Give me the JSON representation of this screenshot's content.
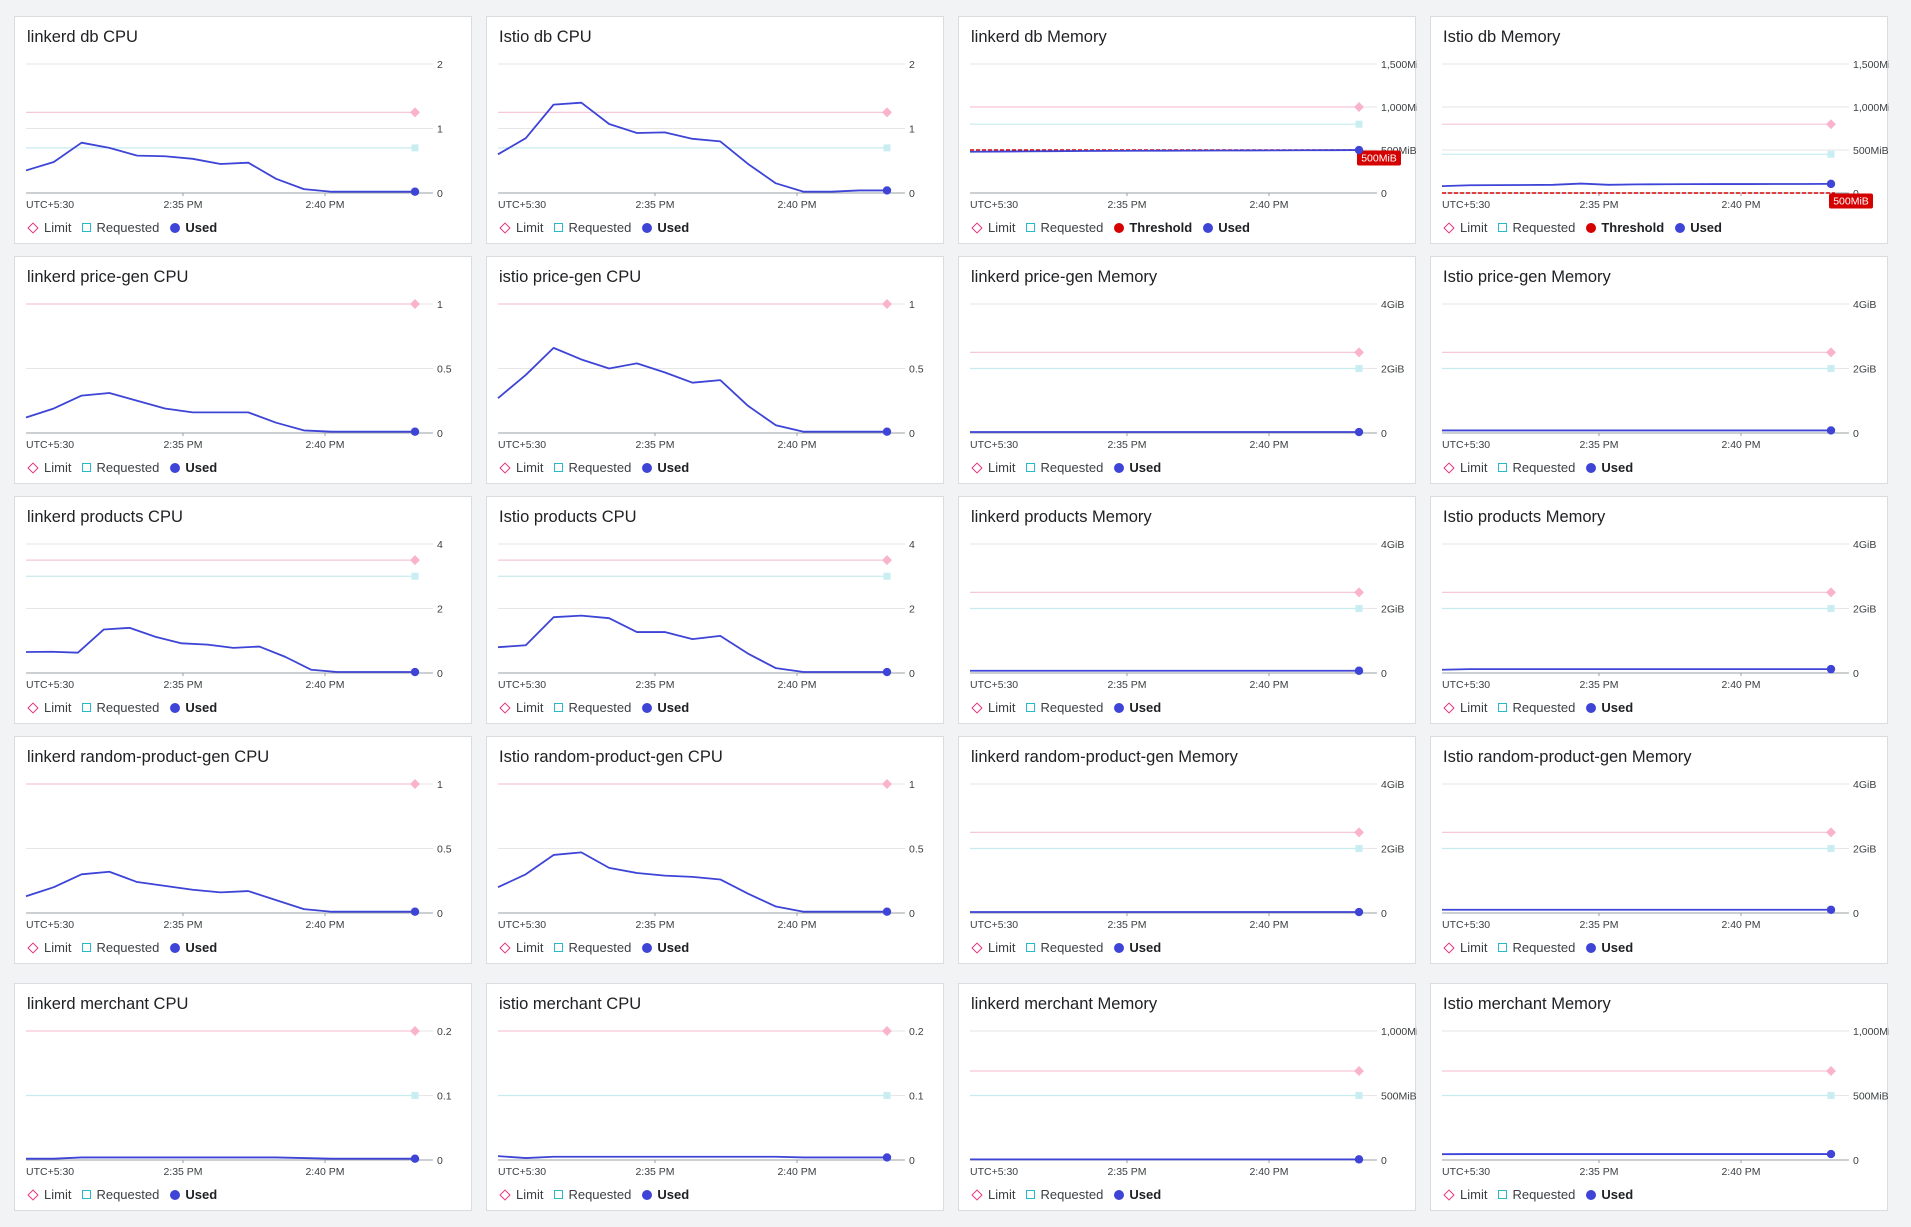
{
  "legend_labels": {
    "limit": "Limit",
    "requested": "Requested",
    "threshold": "Threshold",
    "used": "Used"
  },
  "colors": {
    "used": "#3d44d6",
    "limit": "#f6c6d9",
    "limit_marker": "#f9b3cd",
    "requested": "#c6ecef",
    "requested_marker": "#c9eef2",
    "threshold": "#d50000",
    "grid": "#e6e6e6",
    "axis": "#9aa0a6"
  },
  "chart_data": [
    {
      "type": "line",
      "title": "linkerd db CPU",
      "timezone_label": "UTC+5:30",
      "x_ticks": [
        "2:35 PM",
        "2:40 PM"
      ],
      "y_ticks": [
        "0",
        "1",
        "2"
      ],
      "ylim": [
        0,
        2
      ],
      "limit": 1.25,
      "requested": 0.7,
      "used": [
        0.35,
        0.48,
        0.78,
        0.7,
        0.58,
        0.57,
        0.53,
        0.45,
        0.47,
        0.22,
        0.06,
        0.02,
        0.02,
        0.02,
        0.02
      ]
    },
    {
      "type": "line",
      "title": "Istio db CPU",
      "timezone_label": "UTC+5:30",
      "x_ticks": [
        "2:35 PM",
        "2:40 PM"
      ],
      "y_ticks": [
        "0",
        "1",
        "2"
      ],
      "ylim": [
        0,
        2
      ],
      "limit": 1.25,
      "requested": 0.7,
      "used": [
        0.6,
        0.85,
        1.37,
        1.4,
        1.07,
        0.93,
        0.94,
        0.84,
        0.8,
        0.45,
        0.15,
        0.02,
        0.02,
        0.04,
        0.04
      ]
    },
    {
      "type": "line",
      "title": "linkerd db Memory",
      "timezone_label": "UTC+5:30",
      "x_ticks": [
        "2:35 PM",
        "2:40 PM"
      ],
      "y_ticks": [
        "0",
        "500MiB",
        "1,000MiB",
        "1,500MiB"
      ],
      "ylim": [
        0,
        1500
      ],
      "limit": 1000,
      "requested": 800,
      "threshold": 500,
      "threshold_label": "500MiB",
      "used": [
        480,
        482,
        484,
        486,
        488,
        490,
        491,
        492,
        493,
        494,
        495,
        496,
        497,
        498,
        499
      ]
    },
    {
      "type": "line",
      "title": "Istio db Memory",
      "timezone_label": "UTC+5:30",
      "x_ticks": [
        "2:35 PM",
        "2:40 PM"
      ],
      "y_ticks": [
        "0",
        "500MiB",
        "1,000MiB",
        "1,500MiB"
      ],
      "ylim": [
        0,
        1500
      ],
      "limit": 800,
      "requested": 450,
      "threshold": 0,
      "threshold_label": "500MiB",
      "used": [
        80,
        90,
        92,
        93,
        95,
        110,
        95,
        100,
        102,
        103,
        104,
        104,
        105,
        105,
        106
      ]
    },
    {
      "type": "line",
      "title": "linkerd price-gen CPU",
      "timezone_label": "UTC+5:30",
      "x_ticks": [
        "2:35 PM",
        "2:40 PM"
      ],
      "y_ticks": [
        "0",
        "0.5",
        "1"
      ],
      "ylim": [
        0,
        1
      ],
      "limit": 1.0,
      "requested": null,
      "used": [
        0.12,
        0.19,
        0.29,
        0.31,
        0.25,
        0.19,
        0.16,
        0.16,
        0.16,
        0.08,
        0.02,
        0.01,
        0.01,
        0.01,
        0.01
      ]
    },
    {
      "type": "line",
      "title": "istio price-gen CPU",
      "timezone_label": "UTC+5:30",
      "x_ticks": [
        "2:35 PM",
        "2:40 PM"
      ],
      "y_ticks": [
        "0",
        "0.5",
        "1"
      ],
      "ylim": [
        0,
        1
      ],
      "limit": 1.0,
      "requested": null,
      "used": [
        0.27,
        0.45,
        0.66,
        0.57,
        0.5,
        0.54,
        0.47,
        0.39,
        0.41,
        0.21,
        0.06,
        0.01,
        0.01,
        0.01,
        0.01
      ]
    },
    {
      "type": "line",
      "title": "linkerd price-gen Memory",
      "timezone_label": "UTC+5:30",
      "x_ticks": [
        "2:35 PM",
        "2:40 PM"
      ],
      "y_ticks": [
        "0",
        "2GiB",
        "4GiB"
      ],
      "ylim": [
        0,
        4
      ],
      "limit": 2.5,
      "requested": 2.0,
      "used": [
        0.03,
        0.03,
        0.03,
        0.03,
        0.03,
        0.03,
        0.03,
        0.03,
        0.03,
        0.03,
        0.03,
        0.03,
        0.03,
        0.03,
        0.03
      ]
    },
    {
      "type": "line",
      "title": "Istio price-gen Memory",
      "timezone_label": "UTC+5:30",
      "x_ticks": [
        "2:35 PM",
        "2:40 PM"
      ],
      "y_ticks": [
        "0",
        "2GiB",
        "4GiB"
      ],
      "ylim": [
        0,
        4
      ],
      "limit": 2.5,
      "requested": 2.0,
      "used": [
        0.08,
        0.08,
        0.08,
        0.08,
        0.08,
        0.08,
        0.08,
        0.08,
        0.08,
        0.08,
        0.08,
        0.08,
        0.08,
        0.08,
        0.08
      ]
    },
    {
      "type": "line",
      "title": "linkerd products CPU",
      "timezone_label": "UTC+5:30",
      "x_ticks": [
        "2:35 PM",
        "2:40 PM"
      ],
      "y_ticks": [
        "0",
        "2",
        "4"
      ],
      "ylim": [
        0,
        4
      ],
      "limit": 3.5,
      "requested": 3.0,
      "used": [
        0.65,
        0.66,
        0.63,
        1.35,
        1.4,
        1.12,
        0.92,
        0.88,
        0.78,
        0.82,
        0.5,
        0.1,
        0.03,
        0.03,
        0.03,
        0.03
      ]
    },
    {
      "type": "line",
      "title": "Istio products CPU",
      "timezone_label": "UTC+5:30",
      "x_ticks": [
        "2:35 PM",
        "2:40 PM"
      ],
      "y_ticks": [
        "0",
        "2",
        "4"
      ],
      "ylim": [
        0,
        4
      ],
      "limit": 3.5,
      "requested": 3.0,
      "used": [
        0.8,
        0.86,
        1.73,
        1.78,
        1.7,
        1.27,
        1.27,
        1.05,
        1.15,
        0.6,
        0.15,
        0.03,
        0.03,
        0.03,
        0.03
      ]
    },
    {
      "type": "line",
      "title": "linkerd products Memory",
      "timezone_label": "UTC+5:30",
      "x_ticks": [
        "2:35 PM",
        "2:40 PM"
      ],
      "y_ticks": [
        "0",
        "2GiB",
        "4GiB"
      ],
      "ylim": [
        0,
        4
      ],
      "limit": 2.5,
      "requested": 2.0,
      "used": [
        0.07,
        0.07,
        0.07,
        0.07,
        0.07,
        0.07,
        0.07,
        0.07,
        0.07,
        0.07,
        0.07,
        0.07,
        0.07,
        0.07,
        0.07
      ]
    },
    {
      "type": "line",
      "title": "Istio products Memory",
      "timezone_label": "UTC+5:30",
      "x_ticks": [
        "2:35 PM",
        "2:40 PM"
      ],
      "y_ticks": [
        "0",
        "2GiB",
        "4GiB"
      ],
      "ylim": [
        0,
        4
      ],
      "limit": 2.5,
      "requested": 2.0,
      "used": [
        0.1,
        0.12,
        0.12,
        0.12,
        0.12,
        0.12,
        0.12,
        0.12,
        0.12,
        0.12,
        0.12,
        0.12,
        0.12,
        0.12,
        0.12
      ]
    },
    {
      "type": "line",
      "title": "linkerd random-product-gen CPU",
      "timezone_label": "UTC+5:30",
      "x_ticks": [
        "2:35 PM",
        "2:40 PM"
      ],
      "y_ticks": [
        "0",
        "0.5",
        "1"
      ],
      "ylim": [
        0,
        1
      ],
      "limit": 1.0,
      "requested": null,
      "used": [
        0.13,
        0.2,
        0.3,
        0.32,
        0.24,
        0.21,
        0.18,
        0.16,
        0.17,
        0.1,
        0.03,
        0.01,
        0.01,
        0.01,
        0.01
      ]
    },
    {
      "type": "line",
      "title": "Istio random-product-gen CPU",
      "timezone_label": "UTC+5:30",
      "x_ticks": [
        "2:35 PM",
        "2:40 PM"
      ],
      "y_ticks": [
        "0",
        "0.5",
        "1"
      ],
      "ylim": [
        0,
        1
      ],
      "limit": 1.0,
      "requested": null,
      "used": [
        0.2,
        0.3,
        0.45,
        0.47,
        0.35,
        0.31,
        0.29,
        0.28,
        0.26,
        0.15,
        0.05,
        0.01,
        0.01,
        0.01,
        0.01
      ]
    },
    {
      "type": "line",
      "title": "linkerd random-product-gen Memory",
      "timezone_label": "UTC+5:30",
      "x_ticks": [
        "2:35 PM",
        "2:40 PM"
      ],
      "y_ticks": [
        "0",
        "2GiB",
        "4GiB"
      ],
      "ylim": [
        0,
        4
      ],
      "limit": 2.5,
      "requested": 2.0,
      "used": [
        0.03,
        0.03,
        0.03,
        0.03,
        0.03,
        0.03,
        0.03,
        0.03,
        0.03,
        0.03,
        0.03,
        0.03,
        0.03,
        0.03,
        0.03
      ]
    },
    {
      "type": "line",
      "title": "Istio random-product-gen Memory",
      "timezone_label": "UTC+5:30",
      "x_ticks": [
        "2:35 PM",
        "2:40 PM"
      ],
      "y_ticks": [
        "0",
        "2GiB",
        "4GiB"
      ],
      "ylim": [
        0,
        4
      ],
      "limit": 2.5,
      "requested": 2.0,
      "used": [
        0.1,
        0.1,
        0.1,
        0.1,
        0.1,
        0.1,
        0.1,
        0.1,
        0.1,
        0.1,
        0.1,
        0.1,
        0.1,
        0.1,
        0.1
      ]
    },
    {
      "type": "line",
      "title": "linkerd merchant CPU",
      "timezone_label": "UTC+5:30",
      "x_ticks": [
        "2:35 PM",
        "2:40 PM"
      ],
      "y_ticks": [
        "0",
        "0.1",
        "0.2"
      ],
      "ylim": [
        0,
        0.2
      ],
      "limit": 0.2,
      "requested": 0.1,
      "used": [
        0.002,
        0.002,
        0.004,
        0.004,
        0.004,
        0.004,
        0.004,
        0.004,
        0.004,
        0.004,
        0.003,
        0.002,
        0.002,
        0.002,
        0.002
      ]
    },
    {
      "type": "line",
      "title": "istio merchant CPU",
      "timezone_label": "UTC+5:30",
      "x_ticks": [
        "2:35 PM",
        "2:40 PM"
      ],
      "y_ticks": [
        "0",
        "0.1",
        "0.2"
      ],
      "ylim": [
        0,
        0.2
      ],
      "limit": 0.2,
      "requested": 0.1,
      "used": [
        0.006,
        0.003,
        0.005,
        0.005,
        0.005,
        0.005,
        0.005,
        0.005,
        0.005,
        0.005,
        0.005,
        0.004,
        0.004,
        0.004,
        0.004
      ]
    },
    {
      "type": "line",
      "title": "linkerd merchant Memory",
      "timezone_label": "UTC+5:30",
      "x_ticks": [
        "2:35 PM",
        "2:40 PM"
      ],
      "y_ticks": [
        "0",
        "500MiB",
        "1,000MiB"
      ],
      "ylim": [
        0,
        1000
      ],
      "limit": 690,
      "requested": 500,
      "used": [
        5,
        5,
        5,
        5,
        5,
        5,
        5,
        5,
        5,
        5,
        5,
        5,
        5,
        5,
        5
      ]
    },
    {
      "type": "line",
      "title": "Istio merchant Memory",
      "timezone_label": "UTC+5:30",
      "x_ticks": [
        "2:35 PM",
        "2:40 PM"
      ],
      "y_ticks": [
        "0",
        "500MiB",
        "1,000MiB"
      ],
      "ylim": [
        0,
        1000
      ],
      "limit": 690,
      "requested": 500,
      "used": [
        45,
        46,
        46,
        46,
        46,
        46,
        46,
        46,
        46,
        46,
        46,
        46,
        46,
        46,
        46
      ]
    }
  ]
}
